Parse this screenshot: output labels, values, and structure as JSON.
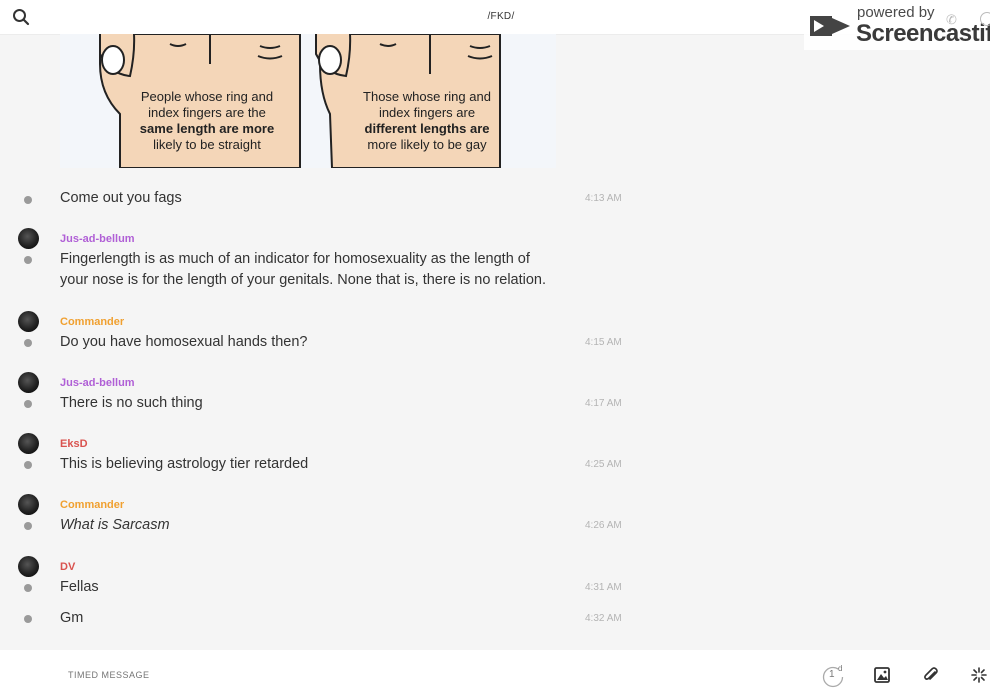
{
  "header": {
    "channel_title": "/FKD/"
  },
  "watermark": {
    "line1": "powered by",
    "line2": "Screencastify"
  },
  "image": {
    "left_caption": [
      "People whose ring and",
      "index fingers are the",
      "same length are more",
      "likely to be straight"
    ],
    "right_caption": [
      "Those whose ring and",
      "index fingers are",
      "different lengths are",
      "more likely to be gay"
    ]
  },
  "messages": [
    {
      "author": "",
      "text": "Come out you fags",
      "time": "4:13 AM"
    },
    {
      "author": "Jus-ad-bellum",
      "author_color": "#b05fd6",
      "text": "Fingerlength is as much of an indicator for homosexuality as the length of your nose is for the length of your genitals. None that is, there is no relation.",
      "time": ""
    },
    {
      "author": "Commander",
      "author_color": "#f0a030",
      "text": "Do you have homosexual hands then?",
      "time": "4:15 AM"
    },
    {
      "author": "Jus-ad-bellum",
      "author_color": "#b05fd6",
      "text": "There is no such thing",
      "time": "4:17 AM"
    },
    {
      "author": "EksD",
      "author_color": "#d9534f",
      "text": "This is believing astrology tier retarded",
      "time": "4:25 AM"
    },
    {
      "author": "Commander",
      "author_color": "#f0a030",
      "text": "What is Sarcasm",
      "time": "4:26 AM"
    },
    {
      "author": "DV",
      "author_color": "#d9534f",
      "text": "Fellas",
      "time": "4:31 AM"
    },
    {
      "author": "",
      "text": "Gm",
      "time": "4:32 AM"
    }
  ],
  "composer": {
    "placeholder": "TIMED MESSAGE",
    "timer_value": "1",
    "timer_unit": "d"
  },
  "colors": {
    "accent_purple": "#b05fd6",
    "accent_orange": "#f0a030",
    "accent_red": "#d9534f"
  },
  "icons": [
    "search-icon",
    "timer-icon",
    "image-icon",
    "paperclip-icon",
    "sparkle-icon"
  ]
}
